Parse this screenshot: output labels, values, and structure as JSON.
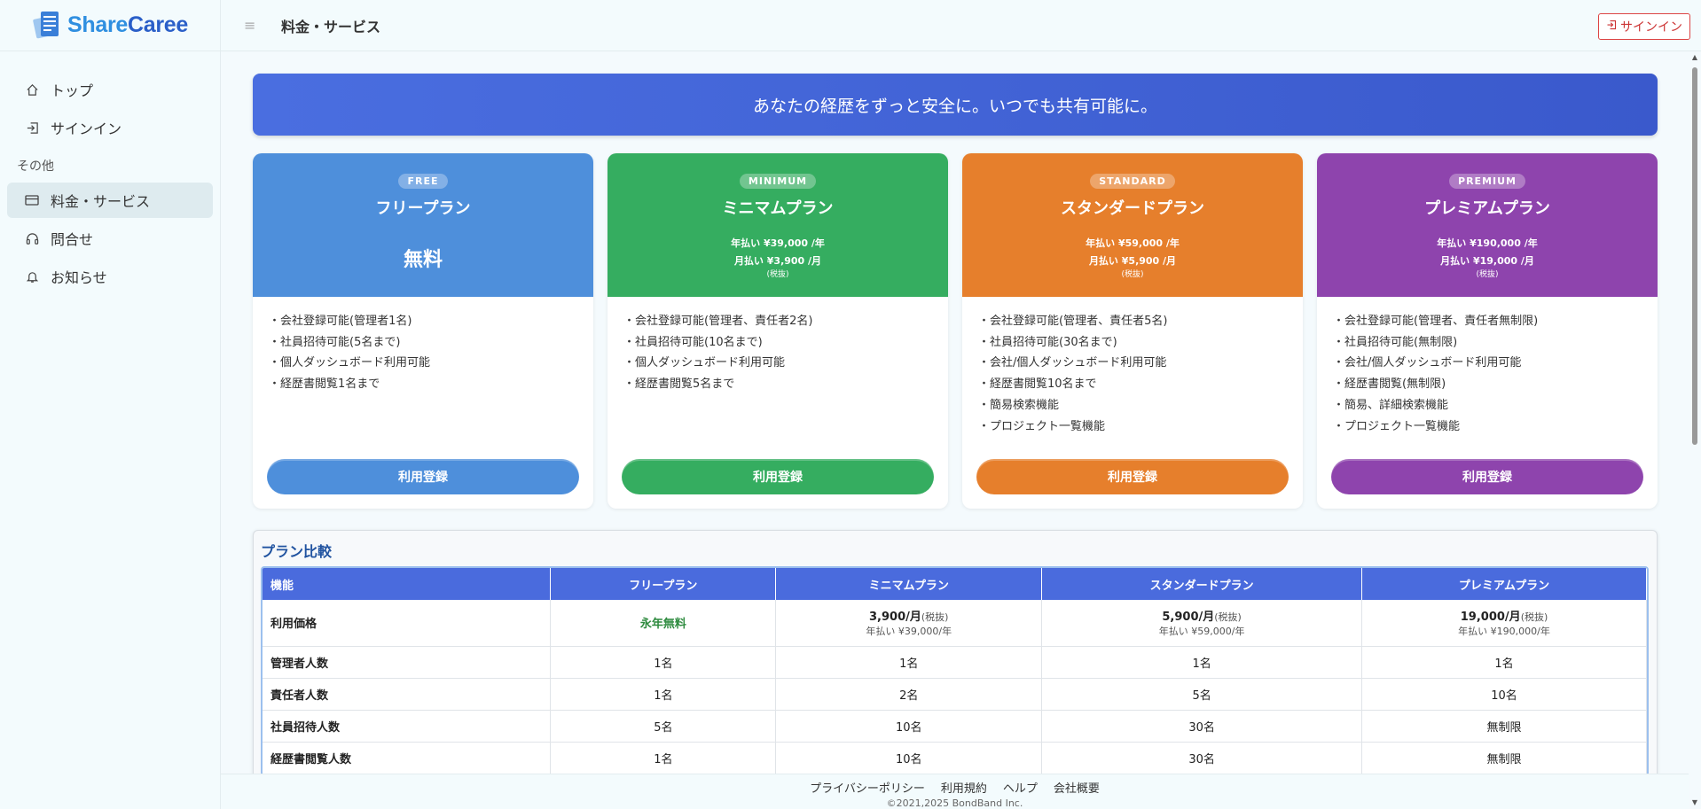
{
  "brand": {
    "name_a": "Share",
    "name_b": "Caree"
  },
  "sidebar": {
    "items": [
      {
        "label": "トップ",
        "icon": "home-icon"
      },
      {
        "label": "サインイン",
        "icon": "signin-icon"
      }
    ],
    "section_label": "その他",
    "others": [
      {
        "label": "料金・サービス",
        "icon": "credit-card-icon",
        "active": true
      },
      {
        "label": "問合せ",
        "icon": "headset-icon"
      },
      {
        "label": "お知らせ",
        "icon": "bell-icon"
      }
    ]
  },
  "header": {
    "title": "料金・サービス",
    "signin_label": "サインイン"
  },
  "hero": {
    "text": "あなたの経歴をずっと安全に。いつでも共有可能に。"
  },
  "plans": [
    {
      "badge": "FREE",
      "name": "フリープラン",
      "price": "無料",
      "features": [
        "・会社登録可能(管理者1名)",
        "・社員招待可能(5名まで)",
        "・個人ダッシュボード利用可能",
        "・経歴書閲覧1名まで"
      ],
      "button": "利用登録",
      "color": "#4e8fdb"
    },
    {
      "badge": "MINIMUM",
      "name": "ミニマムプラン",
      "yearly": "年払い ¥39,000 /年",
      "monthly": "月払い ¥3,900 /月",
      "tax": "(税抜)",
      "features": [
        "・会社登録可能(管理者、責任者2名)",
        "・社員招待可能(10名まで)",
        "・個人ダッシュボード利用可能",
        "・経歴書閲覧5名まで"
      ],
      "button": "利用登録",
      "color": "#35ad60"
    },
    {
      "badge": "STANDARD",
      "name": "スタンダードプラン",
      "yearly": "年払い ¥59,000 /年",
      "monthly": "月払い ¥5,900 /月",
      "tax": "(税抜)",
      "features": [
        "・会社登録可能(管理者、責任者5名)",
        "・社員招待可能(30名まで)",
        "・会社/個人ダッシュボード利用可能",
        "・経歴書閲覧10名まで",
        "・簡易検索機能",
        "・プロジェクト一覧機能"
      ],
      "button": "利用登録",
      "color": "#e67f2c"
    },
    {
      "badge": "PREMIUM",
      "name": "プレミアムプラン",
      "yearly": "年払い ¥190,000 /年",
      "monthly": "月払い ¥19,000 /月",
      "tax": "(税抜)",
      "features": [
        "・会社登録可能(管理者、責任者無制限)",
        "・社員招待可能(無制限)",
        "・会社/個人ダッシュボード利用可能",
        "・経歴書閲覧(無制限)",
        "・簡易、詳細検索機能",
        "・プロジェクト一覧機能"
      ],
      "button": "利用登録",
      "color": "#8e44ad"
    }
  ],
  "comparison": {
    "title": "プラン比較",
    "headers": [
      "機能",
      "フリープラン",
      "ミニマムプラン",
      "スタンダードプラン",
      "プレミアムプラン"
    ],
    "price_row": {
      "label": "利用価格",
      "free": "永年無料",
      "paid": [
        {
          "monthly": "3,900/月",
          "tax": "(税抜)",
          "yearly": "年払い ¥39,000/年"
        },
        {
          "monthly": "5,900/月",
          "tax": "(税抜)",
          "yearly": "年払い ¥59,000/年"
        },
        {
          "monthly": "19,000/月",
          "tax": "(税抜)",
          "yearly": "年払い ¥190,000/年"
        }
      ]
    },
    "rows": [
      [
        "管理者人数",
        "1名",
        "1名",
        "1名",
        "1名"
      ],
      [
        "責任者人数",
        "1名",
        "2名",
        "5名",
        "10名"
      ],
      [
        "社員招待人数",
        "5名",
        "10名",
        "30名",
        "無制限"
      ],
      [
        "経歴書閲覧人数",
        "1名",
        "10名",
        "30名",
        "無制限"
      ]
    ]
  },
  "footer": {
    "links": [
      "プライバシーポリシー",
      "利用規約",
      "ヘルプ",
      "会社概要"
    ],
    "copyright": "©2021,2025 BondBand Inc."
  }
}
